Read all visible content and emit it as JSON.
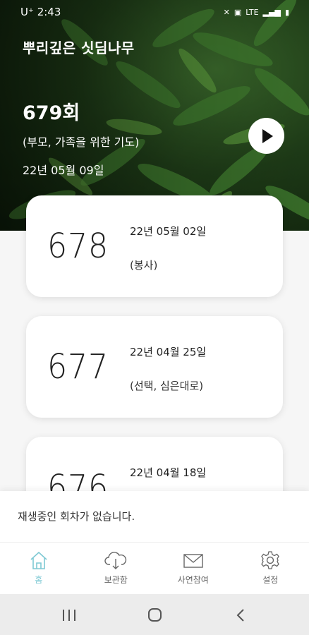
{
  "status_bar": {
    "carrier": "U⁺",
    "time": "2:43",
    "network": "LTE"
  },
  "hero": {
    "title": "뿌리깊은 싯딤나무",
    "count": "679회",
    "subtitle": "(부모, 가족을 위한 기도)",
    "date": "22년 05월 09일"
  },
  "episodes": [
    {
      "number": "678",
      "date": "22년 05월 02일",
      "tag": "(봉사)"
    },
    {
      "number": "677",
      "date": "22년 04월 25일",
      "tag": "(선택, 심은대로)"
    },
    {
      "number": "676",
      "date": "22년 04월 18일",
      "tag": ""
    }
  ],
  "now_playing": {
    "text": "재생중인 회차가 없습니다."
  },
  "nav": {
    "home": "홈",
    "archive": "보관함",
    "story": "사연참여",
    "settings": "설정"
  },
  "colors": {
    "accent": "#7fc9d4"
  }
}
